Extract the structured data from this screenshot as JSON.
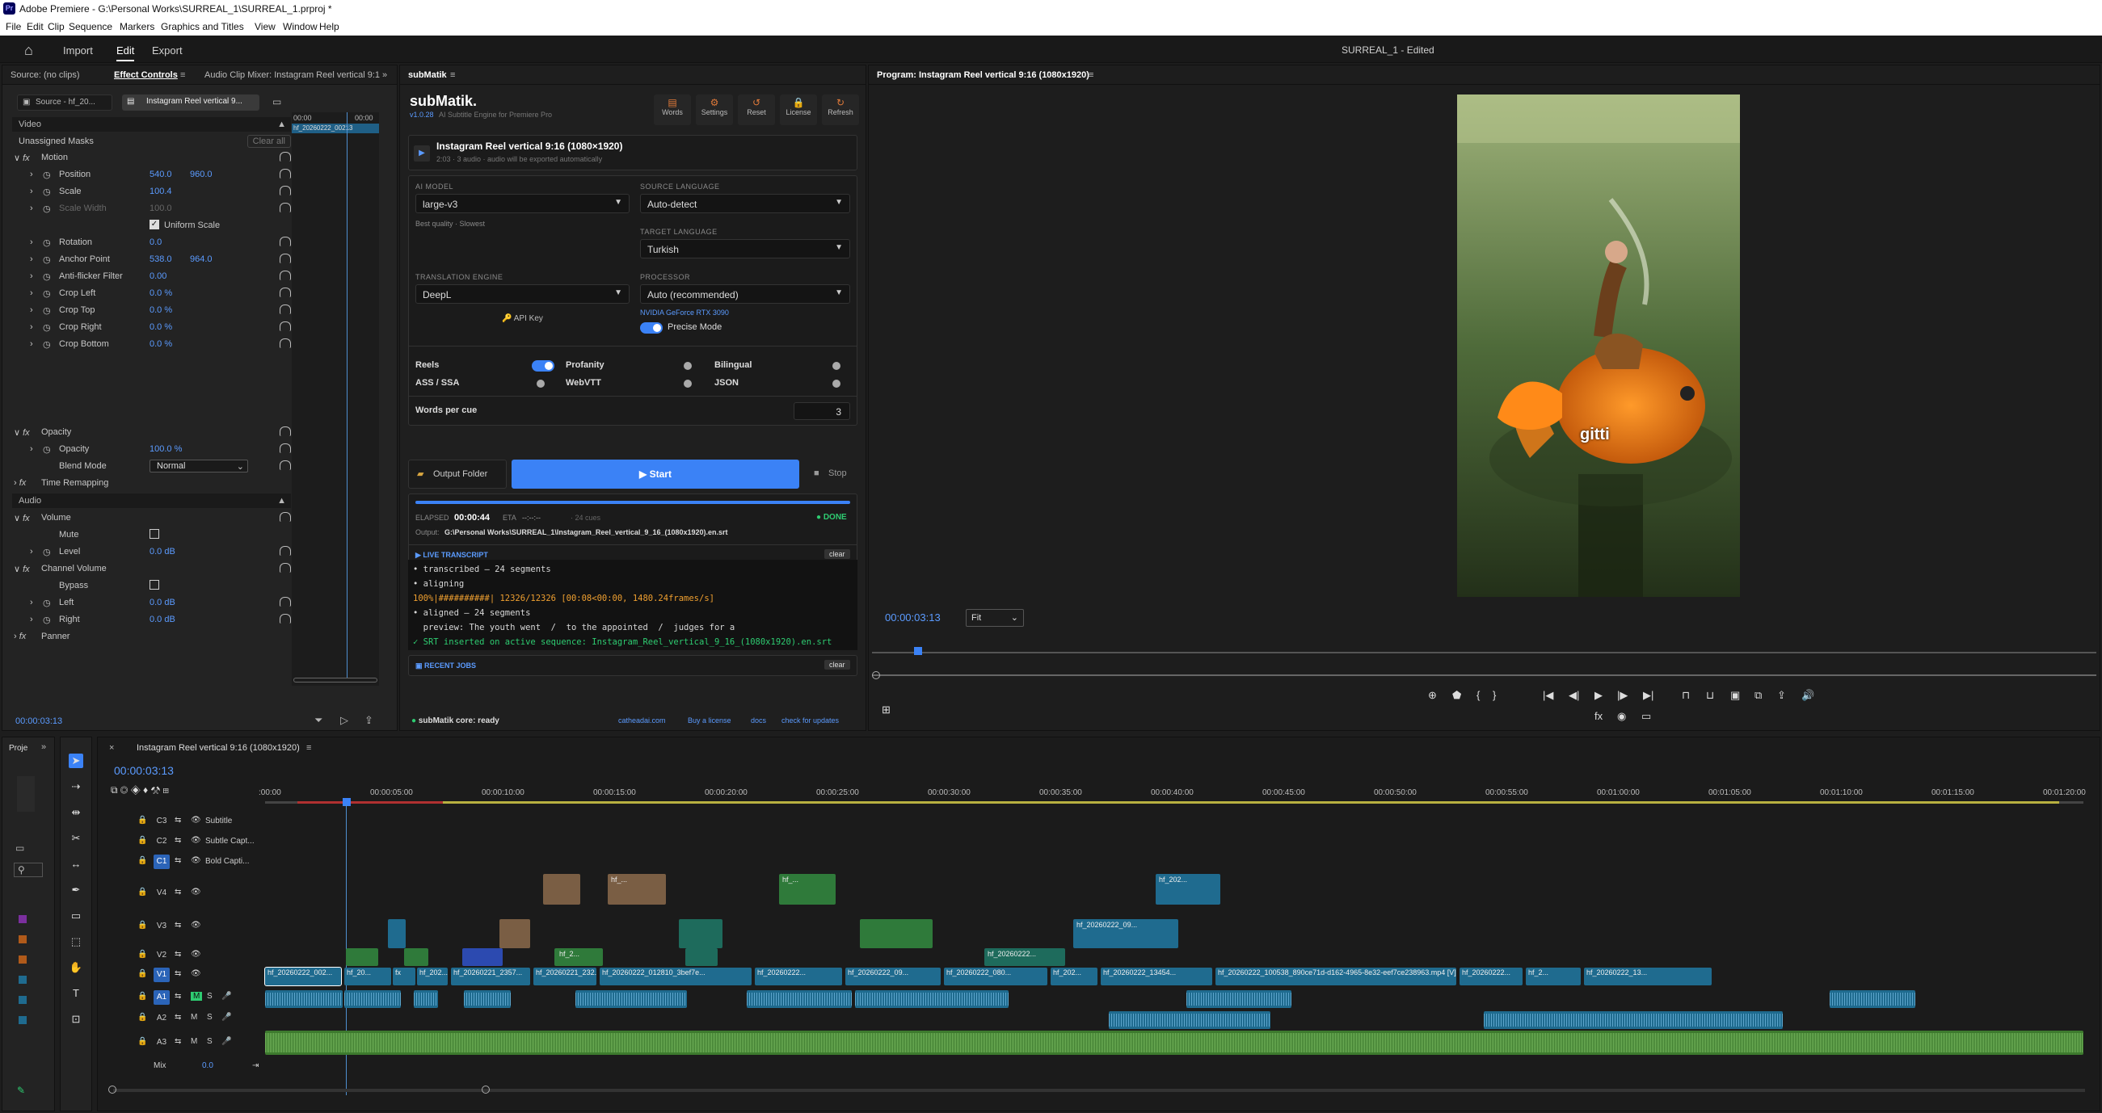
{
  "window": {
    "title": "Adobe Premiere - G:\\Personal Works\\SURREAL_1\\SURREAL_1.prproj *",
    "logo": "Pr"
  },
  "menu": [
    "File",
    "Edit",
    "Clip",
    "Sequence",
    "Markers",
    "Graphics and Titles",
    "View",
    "Window",
    "Help"
  ],
  "topbar": {
    "import": "Import",
    "edit": "Edit",
    "export": "Export",
    "project_status": "SURREAL_1 - Edited"
  },
  "left_panel": {
    "tabs": [
      "Source: (no clips)",
      "Effect Controls",
      "Audio Clip Mixer: Instagram Reel vertical 9:1"
    ],
    "source_tab": "Source - hf_20...",
    "seq_tab": "Instagram Reel vertical 9...",
    "mini_time_start": "00:00",
    "mini_time_end": "00:00",
    "mini_clip": "hf_20260222_00213",
    "current_time": "00:00:03:13"
  },
  "effect_controls": {
    "video": "Video",
    "clear_all": "Clear all",
    "unassigned": "Unassigned Masks",
    "motion": "Motion",
    "rows": [
      {
        "label": "Position",
        "v1": "540.0",
        "v2": "960.0"
      },
      {
        "label": "Scale",
        "v1": "100.4",
        "v2": ""
      },
      {
        "label": "Scale Width",
        "v1": "100.0",
        "v2": ""
      },
      {
        "label": "Uniform Scale",
        "v1": "",
        "v2": ""
      },
      {
        "label": "Rotation",
        "v1": "0.0",
        "v2": ""
      },
      {
        "label": "Anchor Point",
        "v1": "538.0",
        "v2": "964.0"
      },
      {
        "label": "Anti-flicker Filter",
        "v1": "0.00",
        "v2": ""
      },
      {
        "label": "Crop Left",
        "v1": "0.0 %",
        "v2": ""
      },
      {
        "label": "Crop Top",
        "v1": "0.0 %",
        "v2": ""
      },
      {
        "label": "Crop Right",
        "v1": "0.0 %",
        "v2": ""
      },
      {
        "label": "Crop Bottom",
        "v1": "0.0 %",
        "v2": ""
      }
    ],
    "opacity": "Opacity",
    "opacity_val": "100.0 %",
    "blend_mode": "Blend Mode",
    "blend_val": "Normal",
    "time_remap": "Time Remapping",
    "audio": "Audio",
    "volume": "Volume",
    "mute": "Mute",
    "level": "Level",
    "level_val": "0.0 dB",
    "channel_volume": "Channel Volume",
    "bypass": "Bypass",
    "left": "Left",
    "left_val": "0.0 dB",
    "right": "Right",
    "right_val": "0.0 dB",
    "panner": "Panner"
  },
  "submatik": {
    "tab": "subMatik",
    "brand": "subMatik.",
    "version": "v1.0.28",
    "tagline": "AI Subtitle Engine for Premiere Pro",
    "toolbar": [
      "Words",
      "Settings",
      "Reset",
      "License",
      "Refresh"
    ],
    "seq_name": "Instagram Reel vertical 9:16 (1080×1920)",
    "seq_meta": "2:03 · 3 audio · audio will be exported automatically",
    "ai_model_label": "AI MODEL",
    "ai_model": "large-v3",
    "ai_model_hint": "Best quality · Slowest",
    "source_lang_label": "SOURCE LANGUAGE",
    "source_lang": "Auto-detect",
    "target_lang_label": "TARGET LANGUAGE",
    "target_lang": "Turkish",
    "engine_label": "TRANSLATION ENGINE",
    "engine": "DeepL",
    "api_key": "API Key",
    "processor_label": "PROCESSOR",
    "processor": "Auto (recommended)",
    "gpu": "NVIDIA GeForce RTX 3090",
    "precise": "Precise Mode",
    "opts": {
      "reels": "Reels",
      "profanity": "Profanity",
      "bilingual": "Bilingual",
      "ass": "ASS / SSA",
      "webvtt": "WebVTT",
      "json": "JSON"
    },
    "words_per_cue_label": "Words per cue",
    "words_per_cue": "3",
    "output_folder": "Output Folder",
    "start": "Start",
    "stop": "Stop",
    "elapsed_label": "ELAPSED",
    "elapsed": "00:00:44",
    "eta_label": "ETA",
    "eta": "--:--:--",
    "cues": "· 24 cues",
    "done": "DONE",
    "output_label": "Output:",
    "output_path": "G:\\Personal Works\\SURREAL_1\\Instagram_Reel_vertical_9_16_(1080x1920).en.srt",
    "live_transcript": "LIVE TRANSCRIPT",
    "clear": "clear",
    "log": [
      "• transcribed — 24 segments",
      "• aligning",
      "100%|##########| 12326/12326 [00:08<00:00, 1480.24frames/s]",
      "• aligned — 24 segments",
      "  preview: The youth went  /  to the appointed  /  judges for a",
      "✓ SRT inserted on active sequence: Instagram_Reel_vertical_9_16_(1080x1920).en.srt"
    ],
    "recent_jobs": "RECENT JOBS",
    "status": "subMatik core: ready",
    "links": [
      "catheadai.com",
      "Buy a license",
      "docs",
      "check for updates"
    ]
  },
  "program": {
    "title": "Program: Instagram Reel vertical 9:16 (1080x1920)",
    "caption": "gitti",
    "timecode": "00:00:03:13",
    "fit": "Fit"
  },
  "timeline": {
    "tab": "Instagram Reel vertical 9:16 (1080x1920)",
    "timecode": "00:00:03:13",
    "project_tab": "Proje",
    "ruler": [
      ":00:00",
      "00:00:05:00",
      "00:00:10:00",
      "00:00:15:00",
      "00:00:20:00",
      "00:00:25:00",
      "00:00:30:00",
      "00:00:35:00",
      "00:00:40:00",
      "00:00:45:00",
      "00:00:50:00",
      "00:00:55:00",
      "00:01:00:00",
      "00:01:05:00",
      "00:01:10:00",
      "00:01:15:00",
      "00:01:20:00"
    ],
    "tracks": {
      "c3": "C3",
      "c2": "C2",
      "c1": "C1",
      "c3n": "Subtitle",
      "c2n": "Subtle Capt...",
      "c1n": "Bold Capti...",
      "v4": "V4",
      "v3": "V3",
      "v2": "V2",
      "v1": "V1",
      "a1": "A1",
      "a2": "A2",
      "a3": "A3",
      "mix": "Mix",
      "mix_val": "0.0"
    },
    "v1_clips": [
      "hf_20260222_002...",
      "hf_20...",
      "fx",
      "hf_202...",
      "hf_20260221_2357...",
      "hf_20260221_232...",
      "hf_20260222_012810_3bef7e...",
      "hf_20260222...",
      "hf_20260222_09...",
      "hf_20260222_080...",
      "hf_202...",
      "hf_20260222_13454...",
      "hf_20260222_100538_890ce71d-d162-4965-8e32-eef7ce238963.mp4 [V] [95...",
      "hf_20260222...",
      "hf_2...",
      "hf_20260222_13..."
    ],
    "v2_clips": [
      "hf_2...",
      "hf_20260222..."
    ],
    "v3_clips": [
      "hf_20260222_09..."
    ],
    "v4_clips": [
      "hf_...",
      "hf_...",
      "hf_202..."
    ]
  },
  "colors": {
    "accent": "#3b82f6",
    "clip_blue": "#1f6b8f",
    "clip_green": "#2f7a3a",
    "clip_teal": "#1e6b5c",
    "clip_tan": "#7a5e44",
    "audio_green": "#3d7a2e",
    "done": "#2ecc71"
  }
}
